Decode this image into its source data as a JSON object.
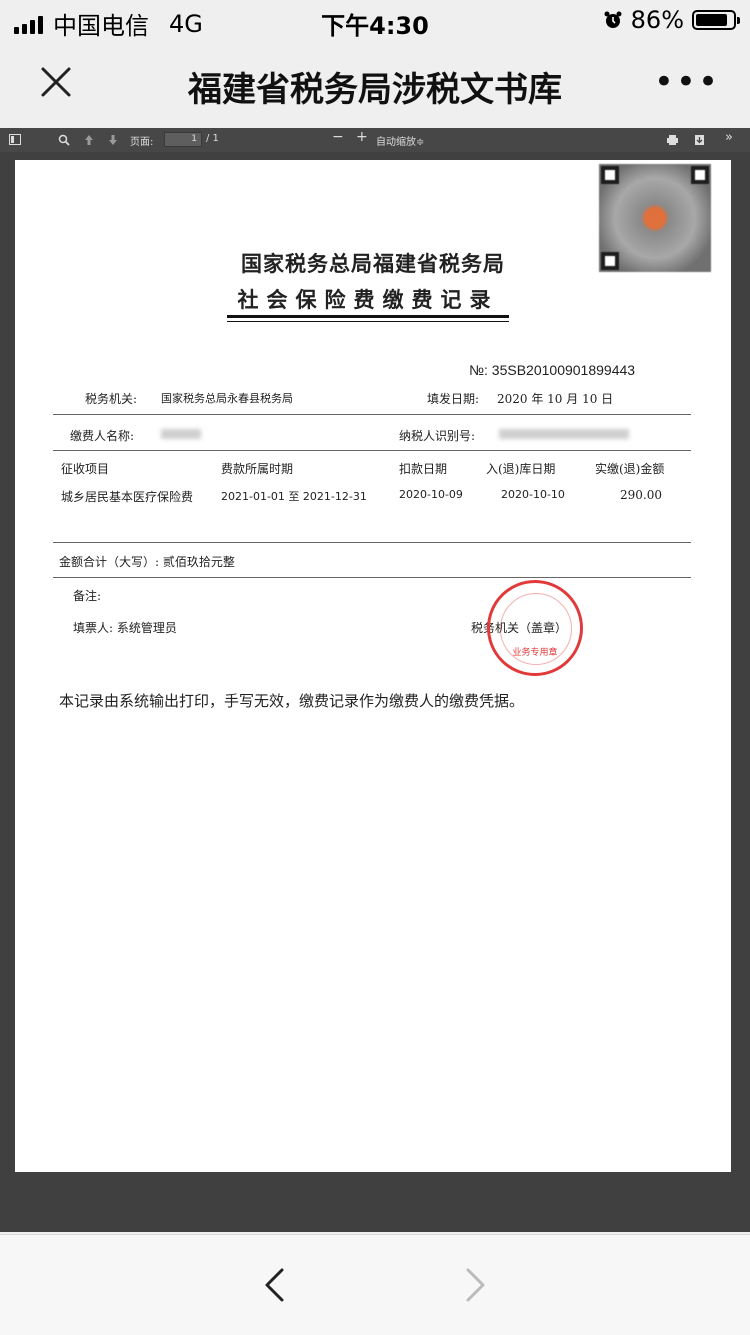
{
  "status_bar": {
    "carrier": "中国电信",
    "network": "4G",
    "time": "下午4:30",
    "battery_percent": "86%",
    "battery_level": 0.86,
    "icons": [
      "signal-icon",
      "alarm-icon",
      "battery-icon"
    ]
  },
  "nav": {
    "title": "福建省税务局涉税文书库",
    "close_icon": "close-icon",
    "more_label": "•••"
  },
  "pdf_toolbar": {
    "page_label": "页面:",
    "page_current": "1",
    "page_total": "/ 1",
    "zoom_out": "−",
    "zoom_in": "+",
    "zoom_select": "自动缩放≑",
    "more": "»"
  },
  "document": {
    "title_line1": "国家税务总局福建省税务局",
    "title_line2": "社会保险费缴费记录",
    "number": "№: 35SB20100901899443",
    "tax_office_label": "税务机关:",
    "tax_office_value": "国家税务总局永春县税务局",
    "issue_date_label": "填发日期:",
    "issue_date_value": "2020 年 10 月 10 日",
    "payer_name_label": "缴费人名称:",
    "taxpayer_id_label": "纳税人识别号:",
    "columns": [
      "征收项目",
      "费款所属时期",
      "扣款日期",
      "入(退)库日期",
      "实缴(退)金额"
    ],
    "rows": [
      [
        "城乡居民基本医疗保险费",
        "2021-01-01 至 2021-12-31",
        "2020-10-09",
        "2020-10-10",
        "290.00"
      ]
    ],
    "total_label": "金额合计（大写）: 贰佰玖拾元整",
    "remark_label": "备注:",
    "issuer_label": "填票人: 系统管理员",
    "seal_label": "税务机关（盖章）",
    "stamp_text": "业务专用章",
    "footer_note": "本记录由系统输出打印，手写无效，缴费记录作为缴费人的缴费凭据。"
  },
  "bottom_nav": {
    "back_icon": "back-arrow-icon",
    "forward_icon": "forward-arrow-icon"
  },
  "colors": {
    "stamp_red": "#e03a3a",
    "viewer_bg": "#404040",
    "toolbar_bg": "#474747"
  }
}
